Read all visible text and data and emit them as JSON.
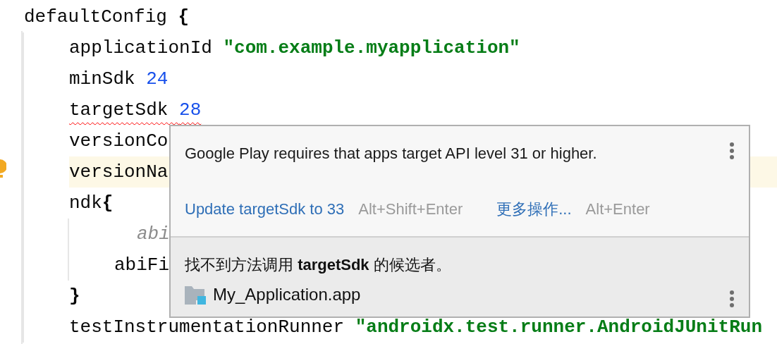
{
  "editor": {
    "lines": [
      {
        "tokens": [
          {
            "kind": "plain",
            "text": "defaultConfig"
          },
          {
            "kind": "brace",
            "text": "{"
          }
        ],
        "error": false,
        "highlighted": false,
        "children": [
          {
            "tokens": [
              {
                "kind": "plain",
                "text": "applicationId"
              },
              {
                "kind": "string",
                "text": "\"com.example.myapplication\""
              }
            ],
            "error": false,
            "highlighted": false
          },
          {
            "tokens": [
              {
                "kind": "plain",
                "text": "minSdk"
              },
              {
                "kind": "number",
                "text": "24"
              }
            ],
            "error": false,
            "highlighted": false
          },
          {
            "tokens": [
              {
                "kind": "plain",
                "text": "targetSdk"
              },
              {
                "kind": "number",
                "text": "28"
              }
            ],
            "error": true,
            "highlighted": false
          },
          {
            "tokens": [
              {
                "kind": "plain",
                "text": "versionCo"
              }
            ],
            "error": false,
            "highlighted": false
          },
          {
            "tokens": [
              {
                "kind": "plain",
                "text": "versionNa"
              }
            ],
            "error": false,
            "highlighted": true
          },
          {
            "tokens": [
              {
                "kind": "plain",
                "text": "ndk"
              },
              {
                "kind": "brace",
                "text": "{",
                "joined": true
              }
            ],
            "error": false,
            "highlighted": false,
            "children": [
              {
                "tokens": [
                  {
                    "kind": "comment",
                    "text": "abi"
                  }
                ],
                "error": false,
                "highlighted": false
              },
              {
                "tokens": [
                  {
                    "kind": "plain",
                    "text": "abiFi"
                  }
                ],
                "error": false,
                "highlighted": false
              }
            ]
          },
          {
            "tokens": [
              {
                "kind": "brace",
                "text": "}"
              }
            ],
            "error": false,
            "highlighted": false
          },
          {
            "tokens": [
              {
                "kind": "plain",
                "text": "testInstrumentationRunner"
              },
              {
                "kind": "string",
                "text": "\"androidx.test.runner.AndroidJUnitRun"
              }
            ],
            "error": false,
            "highlighted": false
          }
        ]
      }
    ]
  },
  "popup": {
    "message": "Google Play requires that apps target API level 31 or higher.",
    "actions": [
      {
        "label": "Update targetSdk to 33",
        "shortcut": "Alt+Shift+Enter"
      },
      {
        "label": "更多操作...",
        "shortcut": "Alt+Enter"
      }
    ],
    "detail": "找不到方法调用 **targetSdk** 的候选者。",
    "module": "My_Application.app"
  }
}
